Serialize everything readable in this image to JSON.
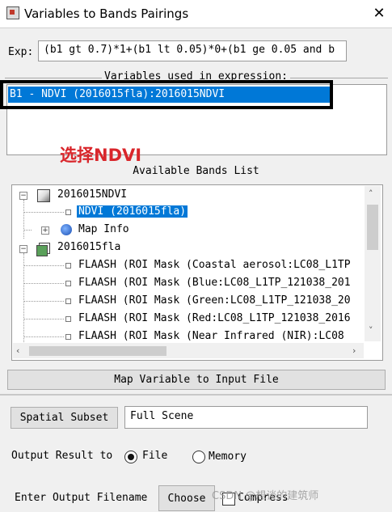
{
  "window": {
    "title": "Variables to Bands Pairings",
    "close_glyph": "✕"
  },
  "expression": {
    "label": "Exp:",
    "value": "(b1 gt 0.7)*1+(b1 lt 0.05)*0+(b1 ge 0.05 and b"
  },
  "variables": {
    "label": "Variables used in expression:",
    "items": [
      "B1 - NDVI (2016015fla):2016015NDVI"
    ]
  },
  "annotation": {
    "text": "选择NDVI",
    "color": "#d9262b"
  },
  "bands": {
    "label": "Available Bands List",
    "tree": [
      {
        "level": 0,
        "expander": "−",
        "icon": "image-file-icon",
        "label": "2016015NDVI"
      },
      {
        "level": 1,
        "icon": "leaf-icon",
        "label": "NDVI (2016015fla)",
        "selected": true
      },
      {
        "level": 1,
        "expander": "+",
        "icon": "globe-icon",
        "label": "Map Info"
      },
      {
        "level": 0,
        "expander": "−",
        "icon": "multiband-file-icon",
        "label": "2016015fla"
      },
      {
        "level": 1,
        "icon": "leaf-icon",
        "label": "FLAASH (ROI Mask (Coastal aerosol:LC08_L1TP"
      },
      {
        "level": 1,
        "icon": "leaf-icon",
        "label": "FLAASH (ROI Mask (Blue:LC08_L1TP_121038_201"
      },
      {
        "level": 1,
        "icon": "leaf-icon",
        "label": "FLAASH (ROI Mask (Green:LC08_L1TP_121038_20"
      },
      {
        "level": 1,
        "icon": "leaf-icon",
        "label": "FLAASH (ROI Mask (Red:LC08_L1TP_121038_2016"
      },
      {
        "level": 1,
        "icon": "leaf-icon",
        "label": "FLAASH (ROI Mask (Near Infrared (NIR):LC08"
      }
    ]
  },
  "buttons": {
    "map_variable": "Map Variable to Input File",
    "spatial_subset": "Spatial Subset",
    "choose": "Choose"
  },
  "subset": {
    "value": "Full Scene"
  },
  "output": {
    "label": "Output Result to",
    "options": [
      "File",
      "Memory"
    ],
    "selected": "File",
    "filename_label": "Enter Output Filename",
    "compress_label": "Compress"
  },
  "watermark": "CSDN @想谈的建筑师",
  "colors": {
    "selection": "#0078d7",
    "dialog_bg": "#f0f0f0"
  }
}
